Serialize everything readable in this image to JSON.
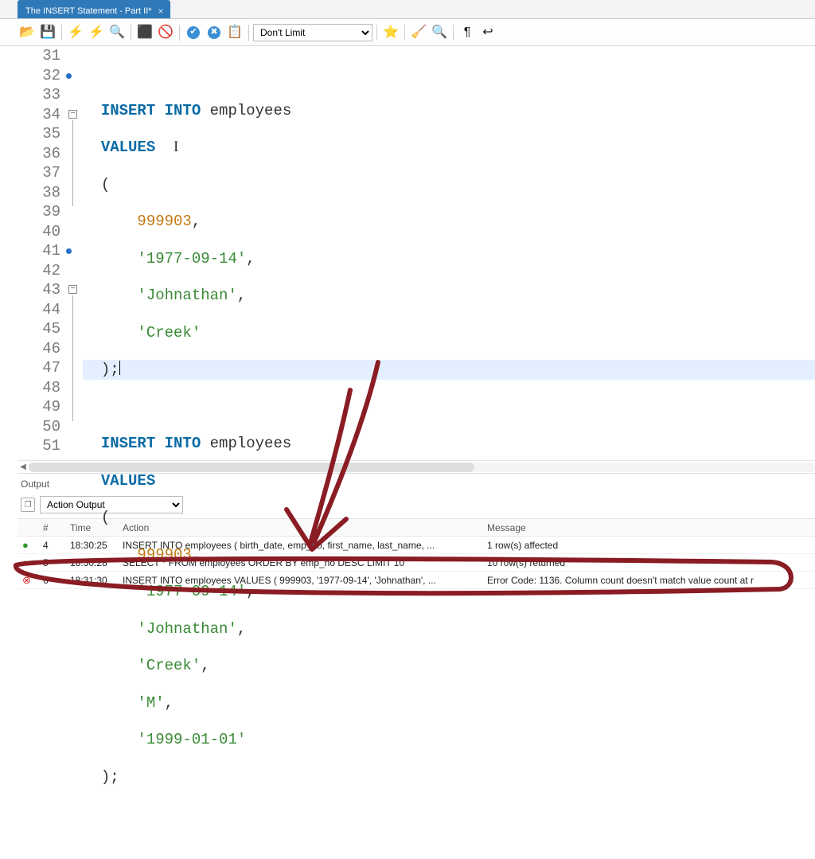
{
  "tab": {
    "title": "The INSERT Statement - Part II*"
  },
  "toolbar": {
    "limit_options": [
      "Don't Limit"
    ]
  },
  "editor": {
    "line_numbers": [
      31,
      32,
      33,
      34,
      35,
      36,
      37,
      38,
      39,
      40,
      41,
      42,
      43,
      44,
      45,
      46,
      47,
      48,
      49,
      50,
      51
    ],
    "marked_lines": [
      32,
      41
    ],
    "highlight_line": 39,
    "code": {
      "kw_insert_into": "INSERT INTO",
      "kw_values": "VALUES",
      "ident_employees": "employees",
      "open_paren": "(",
      "close_stmt": ");",
      "close_block": ");",
      "num_999903": "999903",
      "str_1977": "'1977-09-14'",
      "str_john": "'Johnathan'",
      "str_creek": "'Creek'",
      "str_m": "'M'",
      "str_1999": "'1999-01-01'",
      "comma": ","
    }
  },
  "output": {
    "panel_title": "Output",
    "selector_label": "Action Output",
    "columns": {
      "num": "#",
      "time": "Time",
      "action": "Action",
      "message": "Message"
    },
    "rows": [
      {
        "status": "ok",
        "num": "4",
        "time": "18:30:25",
        "action": "INSERT INTO employees ( birth_date,     emp_no,     first_name,     last_name,    ...",
        "message": "1 row(s) affected"
      },
      {
        "status": "ok",
        "num": "5",
        "time": "18:30:28",
        "action": "SELECT     * FROM     employees ORDER BY emp_no DESC LIMIT 10",
        "message": "10 row(s) returned"
      },
      {
        "status": "err",
        "num": "6",
        "time": "18:31:30",
        "action": "INSERT INTO employees VALUES (  999903,     '1977-09-14',     'Johnathan',    ...",
        "message": "Error Code: 1136. Column count doesn't match value count at r"
      }
    ]
  }
}
